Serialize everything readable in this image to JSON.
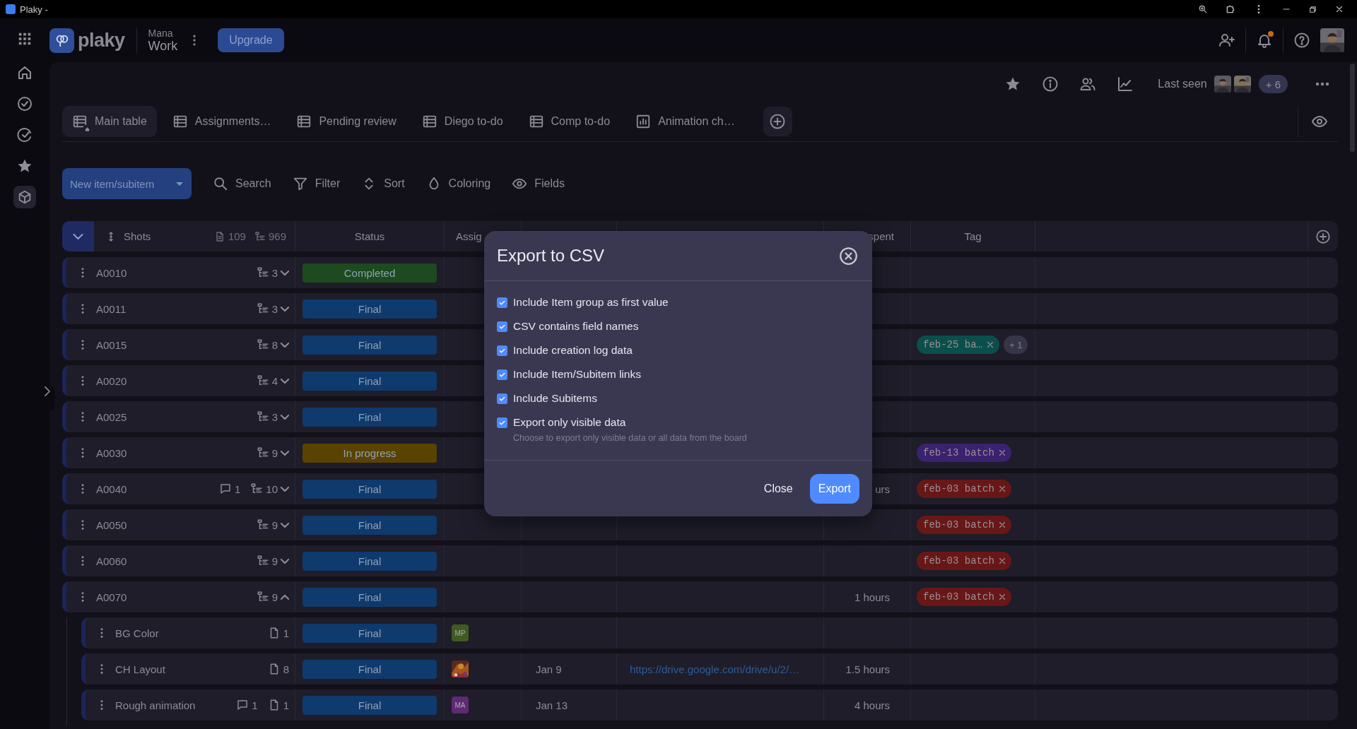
{
  "window": {
    "title": "Plaky -"
  },
  "header": {
    "logo_text": "plaky",
    "workspace_top": "Mana",
    "workspace_bottom": "Work",
    "upgrade_button": "Upgrade",
    "has_notifications": true
  },
  "board": {
    "last_seen_label": "Last seen",
    "last_seen_more": "+ 6"
  },
  "tabs": [
    {
      "label": "Main table",
      "kind": "table",
      "is_default": true,
      "selected": true
    },
    {
      "label": "Assignments…",
      "kind": "table",
      "is_default": false,
      "selected": false
    },
    {
      "label": "Pending review",
      "kind": "table",
      "is_default": false,
      "selected": false
    },
    {
      "label": "Diego to-do",
      "kind": "table",
      "is_default": false,
      "selected": false
    },
    {
      "label": "Comp to-do",
      "kind": "table",
      "is_default": false,
      "selected": false
    },
    {
      "label": "Animation ch…",
      "kind": "chart",
      "is_default": false,
      "selected": false
    }
  ],
  "toolbar": {
    "new_item_button": "New item/subitem",
    "actions": [
      {
        "label": "Search",
        "kind": "search"
      },
      {
        "label": "Filter",
        "kind": "filter"
      },
      {
        "label": "Sort",
        "kind": "sort"
      },
      {
        "label": "Coloring",
        "kind": "coloring"
      },
      {
        "label": "Fields",
        "kind": "fields"
      }
    ]
  },
  "table": {
    "header": {
      "name": "Shots",
      "items": "109",
      "subitems": "969",
      "status": "Status",
      "column_3": "Assig",
      "column_6": "spent",
      "tag": "Tag"
    },
    "rows": [
      {
        "name": "A0010",
        "subitems": "3",
        "expanded": false,
        "status": {
          "label": "Completed",
          "color": "#1d4a1e"
        }
      },
      {
        "name": "A0011",
        "subitems": "3",
        "expanded": false,
        "status": {
          "label": "Final",
          "color": "#0e3a6e"
        }
      },
      {
        "name": "A0015",
        "subitems": "8",
        "expanded": false,
        "status": {
          "label": "Final",
          "color": "#0e3a6e"
        },
        "tags": [
          {
            "label": "feb-25 ba…",
            "color": "#0b4f4d"
          }
        ],
        "more_tags": "+ 1"
      },
      {
        "name": "A0020",
        "subitems": "4",
        "expanded": false,
        "status": {
          "label": "Final",
          "color": "#0e3a6e"
        }
      },
      {
        "name": "A0025",
        "subitems": "3",
        "expanded": false,
        "status": {
          "label": "Final",
          "color": "#0e3a6e"
        }
      },
      {
        "name": "A0030",
        "subitems": "9",
        "expanded": false,
        "status": {
          "label": "In progress",
          "color": "#5a4300"
        },
        "tags": [
          {
            "label": "feb-13 batch",
            "color": "#3a2270"
          }
        ]
      },
      {
        "name": "A0040",
        "comments": "1",
        "subitems": "10",
        "expanded": false,
        "status": {
          "label": "Final",
          "color": "#0e3a6e"
        },
        "time_spent": "urs",
        "tags": [
          {
            "label": "feb-03 batch",
            "color": "#681717"
          }
        ]
      },
      {
        "name": "A0050",
        "subitems": "9",
        "expanded": false,
        "status": {
          "label": "Final",
          "color": "#0e3a6e"
        },
        "tags": [
          {
            "label": "feb-03 batch",
            "color": "#681717"
          }
        ]
      },
      {
        "name": "A0060",
        "subitems": "9",
        "expanded": false,
        "status": {
          "label": "Final",
          "color": "#0e3a6e"
        },
        "tags": [
          {
            "label": "feb-03 batch",
            "color": "#681717"
          }
        ]
      },
      {
        "name": "A0070",
        "subitems": "9",
        "expanded": true,
        "status": {
          "label": "Final",
          "color": "#0e3a6e"
        },
        "time_spent": "1 hours",
        "tags": [
          {
            "label": "feb-03 batch",
            "color": "#681717"
          }
        ],
        "children": [
          {
            "name": "BG Color",
            "files": "1",
            "status": {
              "label": "Final",
              "color": "#0e3a6e"
            },
            "assignee": {
              "kind": "initials",
              "initials": "MP",
              "color": "#3e5c1f"
            }
          },
          {
            "name": "CH Layout",
            "files": "8",
            "status": {
              "label": "Final",
              "color": "#0e3a6e"
            },
            "date": "Jan 9",
            "link": "https://drive.google.com/drive/u/2/…",
            "time_spent": "1.5 hours"
          },
          {
            "name": "Rough animation",
            "comments": "1",
            "files": "1",
            "status": {
              "label": "Final",
              "color": "#0e3a6e"
            },
            "assignee": {
              "kind": "initials",
              "initials": "MA",
              "color": "#5e2a74"
            },
            "date": "Jan 13",
            "time_spent": "4 hours"
          }
        ]
      }
    ]
  },
  "dialog": {
    "title": "Export to CSV",
    "options": [
      {
        "label": "Include Item group as first value",
        "checked": true
      },
      {
        "label": "CSV contains field names",
        "checked": true
      },
      {
        "label": "Include creation log data",
        "checked": true
      },
      {
        "label": "Include Item/Subitem links",
        "checked": true
      },
      {
        "label": "Include Subitems",
        "checked": true
      },
      {
        "label": "Export only visible data",
        "checked": true,
        "hint": "Choose to export only visible data or all data from the board"
      }
    ],
    "close_button": "Close",
    "export_button": "Export"
  }
}
